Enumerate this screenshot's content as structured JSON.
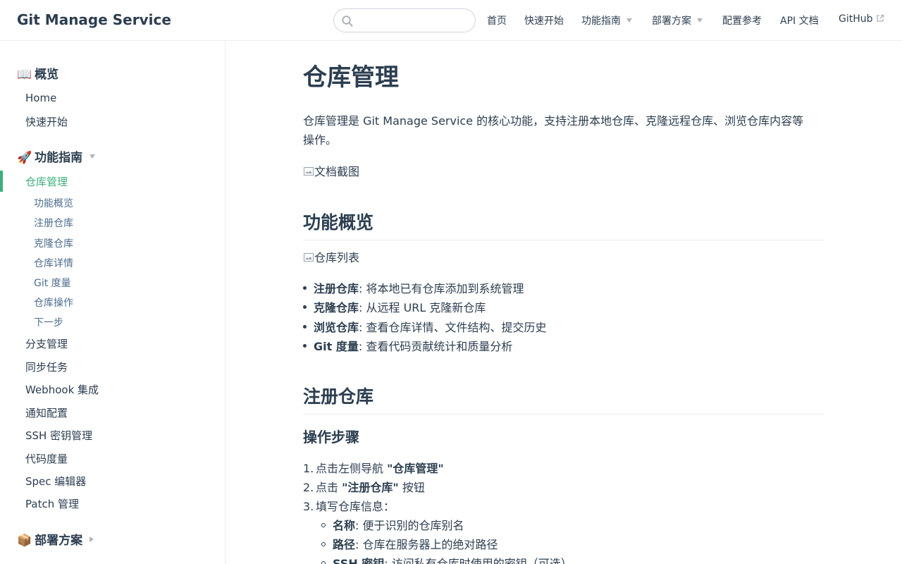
{
  "navbar": {
    "site_name": "Git Manage Service",
    "search_placeholder": "",
    "links": [
      {
        "label": "首页"
      },
      {
        "label": "快速开始"
      },
      {
        "label": "功能指南"
      },
      {
        "label": "部署方案"
      },
      {
        "label": "配置参考"
      },
      {
        "label": "API 文档"
      },
      {
        "label": "GitHub"
      }
    ]
  },
  "sidebar": {
    "group_overview": {
      "emoji": "📖",
      "label": "概览"
    },
    "overview_items": [
      "Home",
      "快速开始"
    ],
    "group_guide": {
      "emoji": "🚀",
      "label": "功能指南"
    },
    "active_item": "仓库管理",
    "sub_items": [
      "功能概览",
      "注册仓库",
      "克隆仓库",
      "仓库详情",
      "Git 度量",
      "仓库操作",
      "下一步"
    ],
    "guide_items": [
      "分支管理",
      "同步任务",
      "Webhook 集成",
      "通知配置",
      "SSH 密钥管理",
      "代码度量",
      "Spec 编辑器",
      "Patch 管理"
    ],
    "group_deploy": {
      "emoji": "📦",
      "label": "部署方案"
    }
  },
  "content": {
    "title": "仓库管理",
    "intro": "仓库管理是 Git Manage Service 的核心功能，支持注册本地仓库、克隆远程仓库、浏览仓库内容等操作。",
    "img_doc_alt": "文档截图",
    "h2_overview": "功能概览",
    "img_list_alt": "仓库列表",
    "features": [
      {
        "term": "注册仓库",
        "desc": ": 将本地已有仓库添加到系统管理"
      },
      {
        "term": "克隆仓库",
        "desc": ": 从远程 URL 克隆新仓库"
      },
      {
        "term": "浏览仓库",
        "desc": ": 查看仓库详情、文件结构、提交历史"
      },
      {
        "term": "Git 度量",
        "desc": ": 查看代码贡献统计和质量分析"
      }
    ],
    "h2_register": "注册仓库",
    "h3_steps": "操作步骤",
    "steps": [
      {
        "num": "1.",
        "pre": "点击左侧导航 ",
        "bold": "\"仓库管理\"",
        "post": ""
      },
      {
        "num": "2.",
        "pre": "点击 ",
        "bold": "\"注册仓库\"",
        "post": " 按钮"
      },
      {
        "num": "3.",
        "pre": "填写仓库信息：",
        "bold": "",
        "post": ""
      }
    ],
    "fields": [
      {
        "term": "名称",
        "desc": ": 便于识别的仓库别名"
      },
      {
        "term": "路径",
        "desc": ": 仓库在服务器上的绝对路径"
      },
      {
        "term": "SSH 密钥",
        "desc": ": 访问私有仓库时使用的密钥（可选）"
      }
    ]
  }
}
